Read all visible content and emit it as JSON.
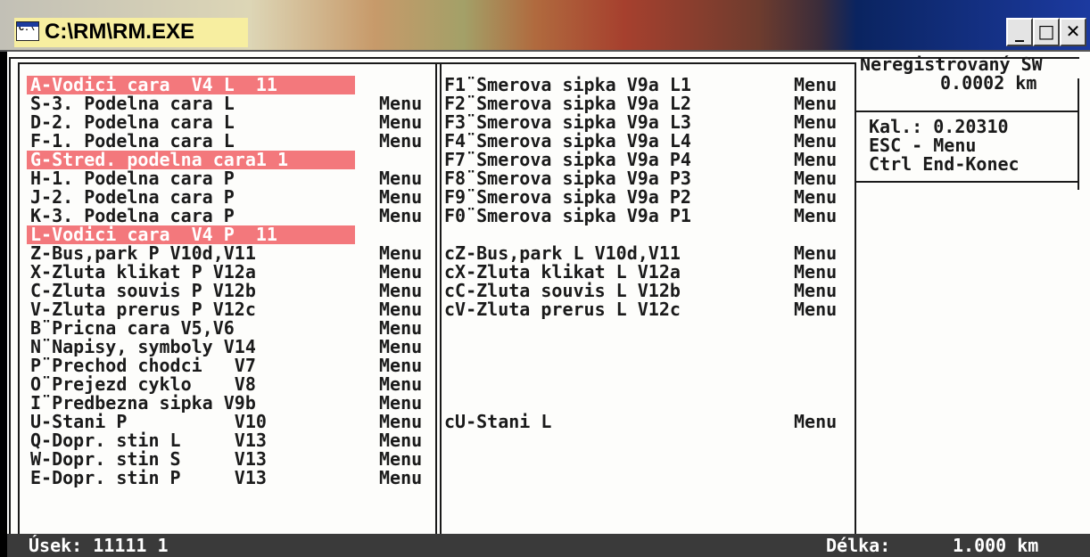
{
  "window": {
    "title": "C:\\RM\\RM.EXE",
    "icon_name": "console-app-icon",
    "icon_text": "C:\\",
    "buttons": {
      "minimize": "_",
      "maximize": "□",
      "close": "✕"
    }
  },
  "left_panel": {
    "items": [
      {
        "label": "A-Vodici cara  V4 L  11",
        "menu": "",
        "highlight": true
      },
      {
        "label": "S-3. Podelna cara L",
        "menu": "Menu",
        "highlight": false
      },
      {
        "label": "D-2. Podelna cara L",
        "menu": "Menu",
        "highlight": false
      },
      {
        "label": "F-1. Podelna cara L",
        "menu": "Menu",
        "highlight": false
      },
      {
        "label": "G-Stred. podelna cara1 1",
        "menu": "",
        "highlight": true
      },
      {
        "label": "H-1. Podelna cara P",
        "menu": "Menu",
        "highlight": false
      },
      {
        "label": "J-2. Podelna cara P",
        "menu": "Menu",
        "highlight": false
      },
      {
        "label": "K-3. Podelna cara P",
        "menu": "Menu",
        "highlight": false
      },
      {
        "label": "L-Vodici cara  V4 P  11",
        "menu": "",
        "highlight": true
      },
      {
        "label": "Z-Bus,park P V10d,V11",
        "menu": "Menu",
        "highlight": false
      },
      {
        "label": "X-Zluta klikat P V12a",
        "menu": "Menu",
        "highlight": false
      },
      {
        "label": "C-Zluta souvis P V12b",
        "menu": "Menu",
        "highlight": false
      },
      {
        "label": "V-Zluta prerus P V12c",
        "menu": "Menu",
        "highlight": false
      },
      {
        "label": "B¨Pricna cara V5,V6",
        "menu": "Menu",
        "highlight": false
      },
      {
        "label": "N¨Napisy, symboly V14",
        "menu": "Menu",
        "highlight": false
      },
      {
        "label": "P¨Prechod chodci   V7",
        "menu": "Menu",
        "highlight": false
      },
      {
        "label": "O¨Prejezd cyklo    V8",
        "menu": "Menu",
        "highlight": false
      },
      {
        "label": "I¨Predbezna sipka V9b",
        "menu": "Menu",
        "highlight": false
      },
      {
        "label": "U-Stani P          V10",
        "menu": "Menu",
        "highlight": false
      },
      {
        "label": "Q-Dopr. stin L     V13",
        "menu": "Menu",
        "highlight": false
      },
      {
        "label": "W-Dopr. stin S     V13",
        "menu": "Menu",
        "highlight": false
      },
      {
        "label": "E-Dopr. stin P     V13",
        "menu": "Menu",
        "highlight": false
      }
    ]
  },
  "middle_panel": {
    "items": [
      {
        "label": "F1¨Smerova sipka V9a L1",
        "menu": "Menu"
      },
      {
        "label": "F2¨Smerova sipka V9a L2",
        "menu": "Menu"
      },
      {
        "label": "F3¨Smerova sipka V9a L3",
        "menu": "Menu"
      },
      {
        "label": "F4¨Smerova sipka V9a L4",
        "menu": "Menu"
      },
      {
        "label": "F7¨Smerova sipka V9a P4",
        "menu": "Menu"
      },
      {
        "label": "F8¨Smerova sipka V9a P3",
        "menu": "Menu"
      },
      {
        "label": "F9¨Smerova sipka V9a P2",
        "menu": "Menu"
      },
      {
        "label": "F0¨Smerova sipka V9a P1",
        "menu": "Menu"
      },
      {
        "label": "",
        "menu": ""
      },
      {
        "label": "cZ-Bus,park L V10d,V11",
        "menu": "Menu"
      },
      {
        "label": "cX-Zluta klikat L V12a",
        "menu": "Menu"
      },
      {
        "label": "cC-Zluta souvis L V12b",
        "menu": "Menu"
      },
      {
        "label": "cV-Zluta prerus L V12c",
        "menu": "Menu"
      },
      {
        "label": "",
        "menu": ""
      },
      {
        "label": "",
        "menu": ""
      },
      {
        "label": "",
        "menu": ""
      },
      {
        "label": "",
        "menu": ""
      },
      {
        "label": "",
        "menu": ""
      },
      {
        "label": "cU-Stani L",
        "menu": "Menu"
      }
    ]
  },
  "right_panel": {
    "registration": "Neregistrovaný SW",
    "distance": "0.0002 km",
    "calibration": "Kal.: 0.20310",
    "esc_hint": "ESC - Menu",
    "end_hint": "Ctrl End-Konec"
  },
  "status_bar": {
    "segment": "Úsek: 11111 1",
    "length_label": "Délka:",
    "length_value": "1.000 km"
  },
  "colors": {
    "highlight": "#f3787c",
    "console_bg": "#fdfdfb",
    "console_text": "#1a1a1a",
    "status_bg": "#3a3a3a"
  }
}
